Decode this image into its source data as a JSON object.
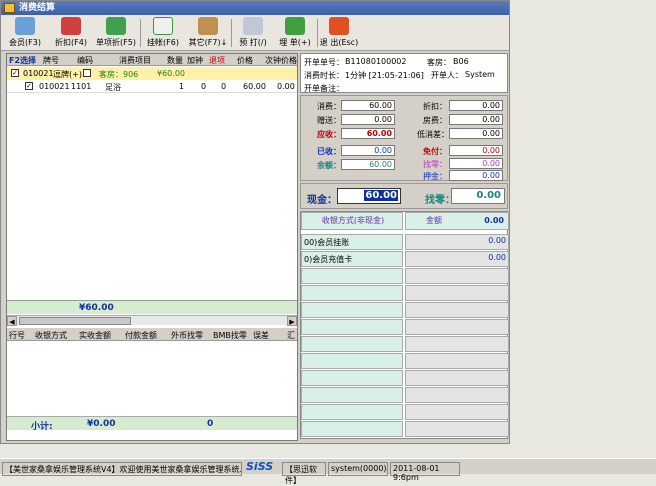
{
  "window": {
    "title": "消费结算"
  },
  "toolbar": {
    "buttons": [
      {
        "label": "会员(F3)"
      },
      {
        "label": "折扣(F4)"
      },
      {
        "label": "单项折(F5)"
      },
      {
        "label": "挂帐(F6)"
      },
      {
        "label": "其它(F7)↓"
      },
      {
        "label": "预 打(/)"
      },
      {
        "label": "埋 单(+)"
      },
      {
        "label": "退 出(Esc)"
      }
    ]
  },
  "grid": {
    "columns": [
      "F2选择",
      "牌号",
      "编码",
      "消费项目",
      "数量",
      "加钟",
      "退项",
      "价格",
      "次钟价格"
    ],
    "group_row": {
      "id": "010021",
      "tag": "逗牌(+)",
      "room": "客房：906",
      "amount": "¥60.00"
    },
    "rows": [
      {
        "check": "✓",
        "id": "010021",
        "code": "1101",
        "item": "足浴",
        "qty": "1",
        "extra": "0",
        "ret": "0",
        "price": "60.00",
        "second": "0.00"
      }
    ],
    "total": "¥60.00"
  },
  "payments_grid": {
    "columns": [
      "行号",
      "收银方式",
      "实收金额",
      "付款金额",
      "外币找零",
      "BMB找零",
      "误差",
      "汇"
    ],
    "subtotal_label": "小计:",
    "subtotal_value": "¥0.00",
    "subtotal_zero": "0"
  },
  "info": {
    "order_no_label": "开单单号：",
    "order_no": "B11080100002",
    "room_label": "客房：",
    "room": "B06",
    "duration_label": "消费时长：",
    "duration": "1分钟 [21:05-21:06]",
    "opener_label": "开单人：",
    "opener": "System",
    "note_label": "开单备注："
  },
  "amounts": {
    "consume_label": "消费：",
    "consume": "60.00",
    "discount_label": "折扣：",
    "discount": "0.00",
    "gift_label": "赠送：",
    "gift": "0.00",
    "roomfee_label": "房费：",
    "roomfee": "0.00",
    "receivable_label": "应收：",
    "receivable": "60.00",
    "minimum_label": "低消差：",
    "minimum": "0.00",
    "received_label": "已收：",
    "received": "0.00",
    "free_label": "免付：",
    "free": "0.00",
    "balance_label": "余额：",
    "balance": "60.00",
    "change_small_label": "找零：",
    "change_small": "0.00",
    "deposit_label": "押金：",
    "deposit": "0.00"
  },
  "cash": {
    "cash_label": "现金：",
    "cash_value": "60.00",
    "change_label": "找零：",
    "change_value": "0.00"
  },
  "pay_methods": {
    "head_method": "收银方式(非现金)",
    "head_amount": "金额",
    "head_total": "0.00",
    "rows": [
      {
        "name": "00)会员挂账",
        "amount": "0.00"
      },
      {
        "name": "0)会员充值卡",
        "amount": "0.00"
      }
    ]
  },
  "taskbar": {
    "app": "【美世家桑拿娱乐管理系统V4】欢迎使用美世家桑拿娱乐管理系统...",
    "logo": "SiSS",
    "company": "【思迅软件】",
    "user": "system(0000)",
    "datetime": "2011-08-01 9:6pm"
  }
}
